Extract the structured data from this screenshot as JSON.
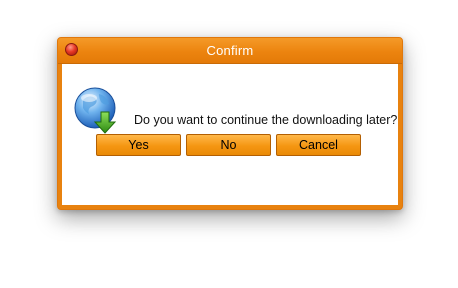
{
  "dialog": {
    "title": "Confirm",
    "message": "Do you want to continue the downloading later?",
    "icon": "globe-download-icon"
  },
  "buttons": {
    "yes_label": "Yes",
    "no_label": "No",
    "cancel_label": "Cancel"
  },
  "colors": {
    "accent": "#ec840f",
    "button": "#f59612",
    "close": "#e83a26"
  }
}
